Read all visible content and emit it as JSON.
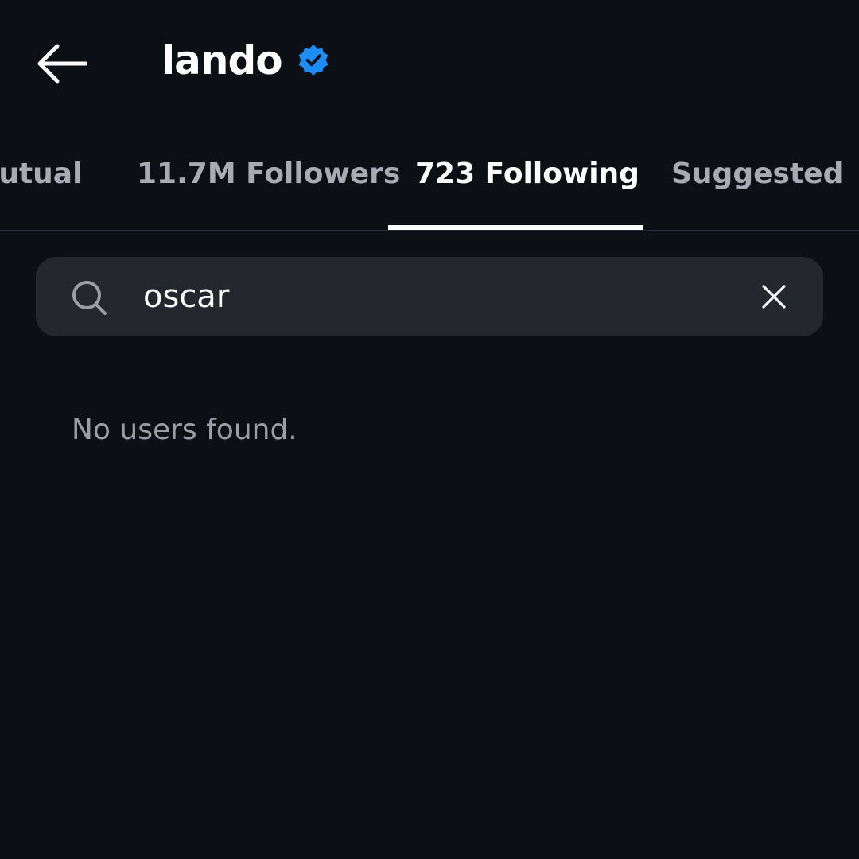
{
  "header": {
    "back_icon": "arrow-left-icon",
    "title": "lando",
    "verified_icon": "verified-badge-icon",
    "accent_color": "#1d8cf5"
  },
  "tabs": [
    {
      "label": "Mutual",
      "visible_label": "lutual",
      "active": false
    },
    {
      "label": "11.7M Followers",
      "active": false
    },
    {
      "label": "723 Following",
      "active": true
    },
    {
      "label": "Suggested",
      "active": false
    }
  ],
  "search": {
    "icon": "search-icon",
    "value": "oscar",
    "clear_icon": "close-icon"
  },
  "results": {
    "empty_message": "No users found."
  }
}
